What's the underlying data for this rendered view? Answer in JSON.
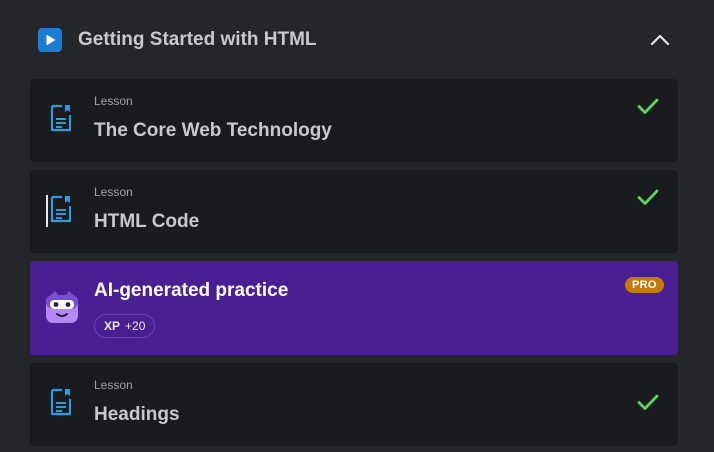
{
  "section": {
    "title": "Getting Started with HTML",
    "icon": "play-icon",
    "toggle_icon": "chevron-up-icon",
    "accent": "#1d7dd2"
  },
  "items": [
    {
      "type": "Lesson",
      "title": "The Core Web Technology",
      "icon": "document-icon",
      "completed": true
    },
    {
      "type": "Lesson",
      "title": "HTML Code",
      "icon": "document-icon",
      "completed": true
    },
    {
      "title": "AI-generated practice",
      "icon": "bot-icon",
      "badge": "PRO",
      "xp_label": "XP",
      "xp_value": "+20",
      "background": "#4a1f94"
    },
    {
      "type": "Lesson",
      "title": "Headings",
      "icon": "document-icon",
      "completed": true
    }
  ],
  "colors": {
    "page_background": "#242629",
    "card_background": "#1a1b1e",
    "check": "#5fd35a",
    "pro_badge": "#c27b0a"
  }
}
